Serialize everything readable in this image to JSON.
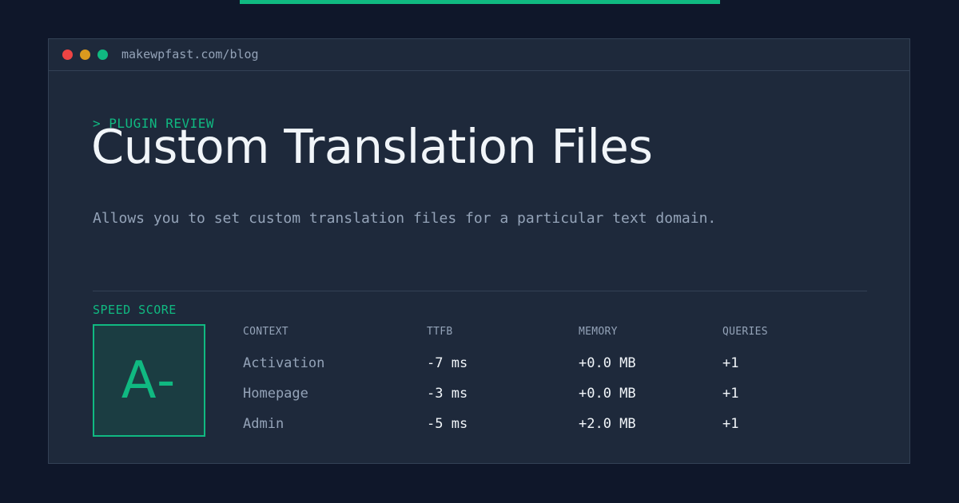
{
  "window": {
    "url": "makewpfast.com/blog",
    "traffic_lights": [
      "#ef4444",
      "#d99a1e",
      "#10b981"
    ]
  },
  "article": {
    "eyebrow": "> PLUGIN REVIEW",
    "title": "Custom Translation Files",
    "description": "Allows you to set custom translation files for a particular text domain."
  },
  "score": {
    "label": "SPEED SCORE",
    "grade": "A-"
  },
  "table": {
    "headers": [
      "CONTEXT",
      "TTFB",
      "MEMORY",
      "QUERIES"
    ],
    "rows": [
      [
        "Activation",
        "-7 ms",
        "+0.0 MB",
        "+1"
      ],
      [
        "Homepage",
        "-3 ms",
        "+0.0 MB",
        "+1"
      ],
      [
        "Admin",
        "-5 ms",
        "+2.0 MB",
        "+1"
      ]
    ]
  },
  "colors": {
    "accent": "#10b981",
    "page_bg": "#0f172a",
    "window_bg": "#1e293b"
  }
}
